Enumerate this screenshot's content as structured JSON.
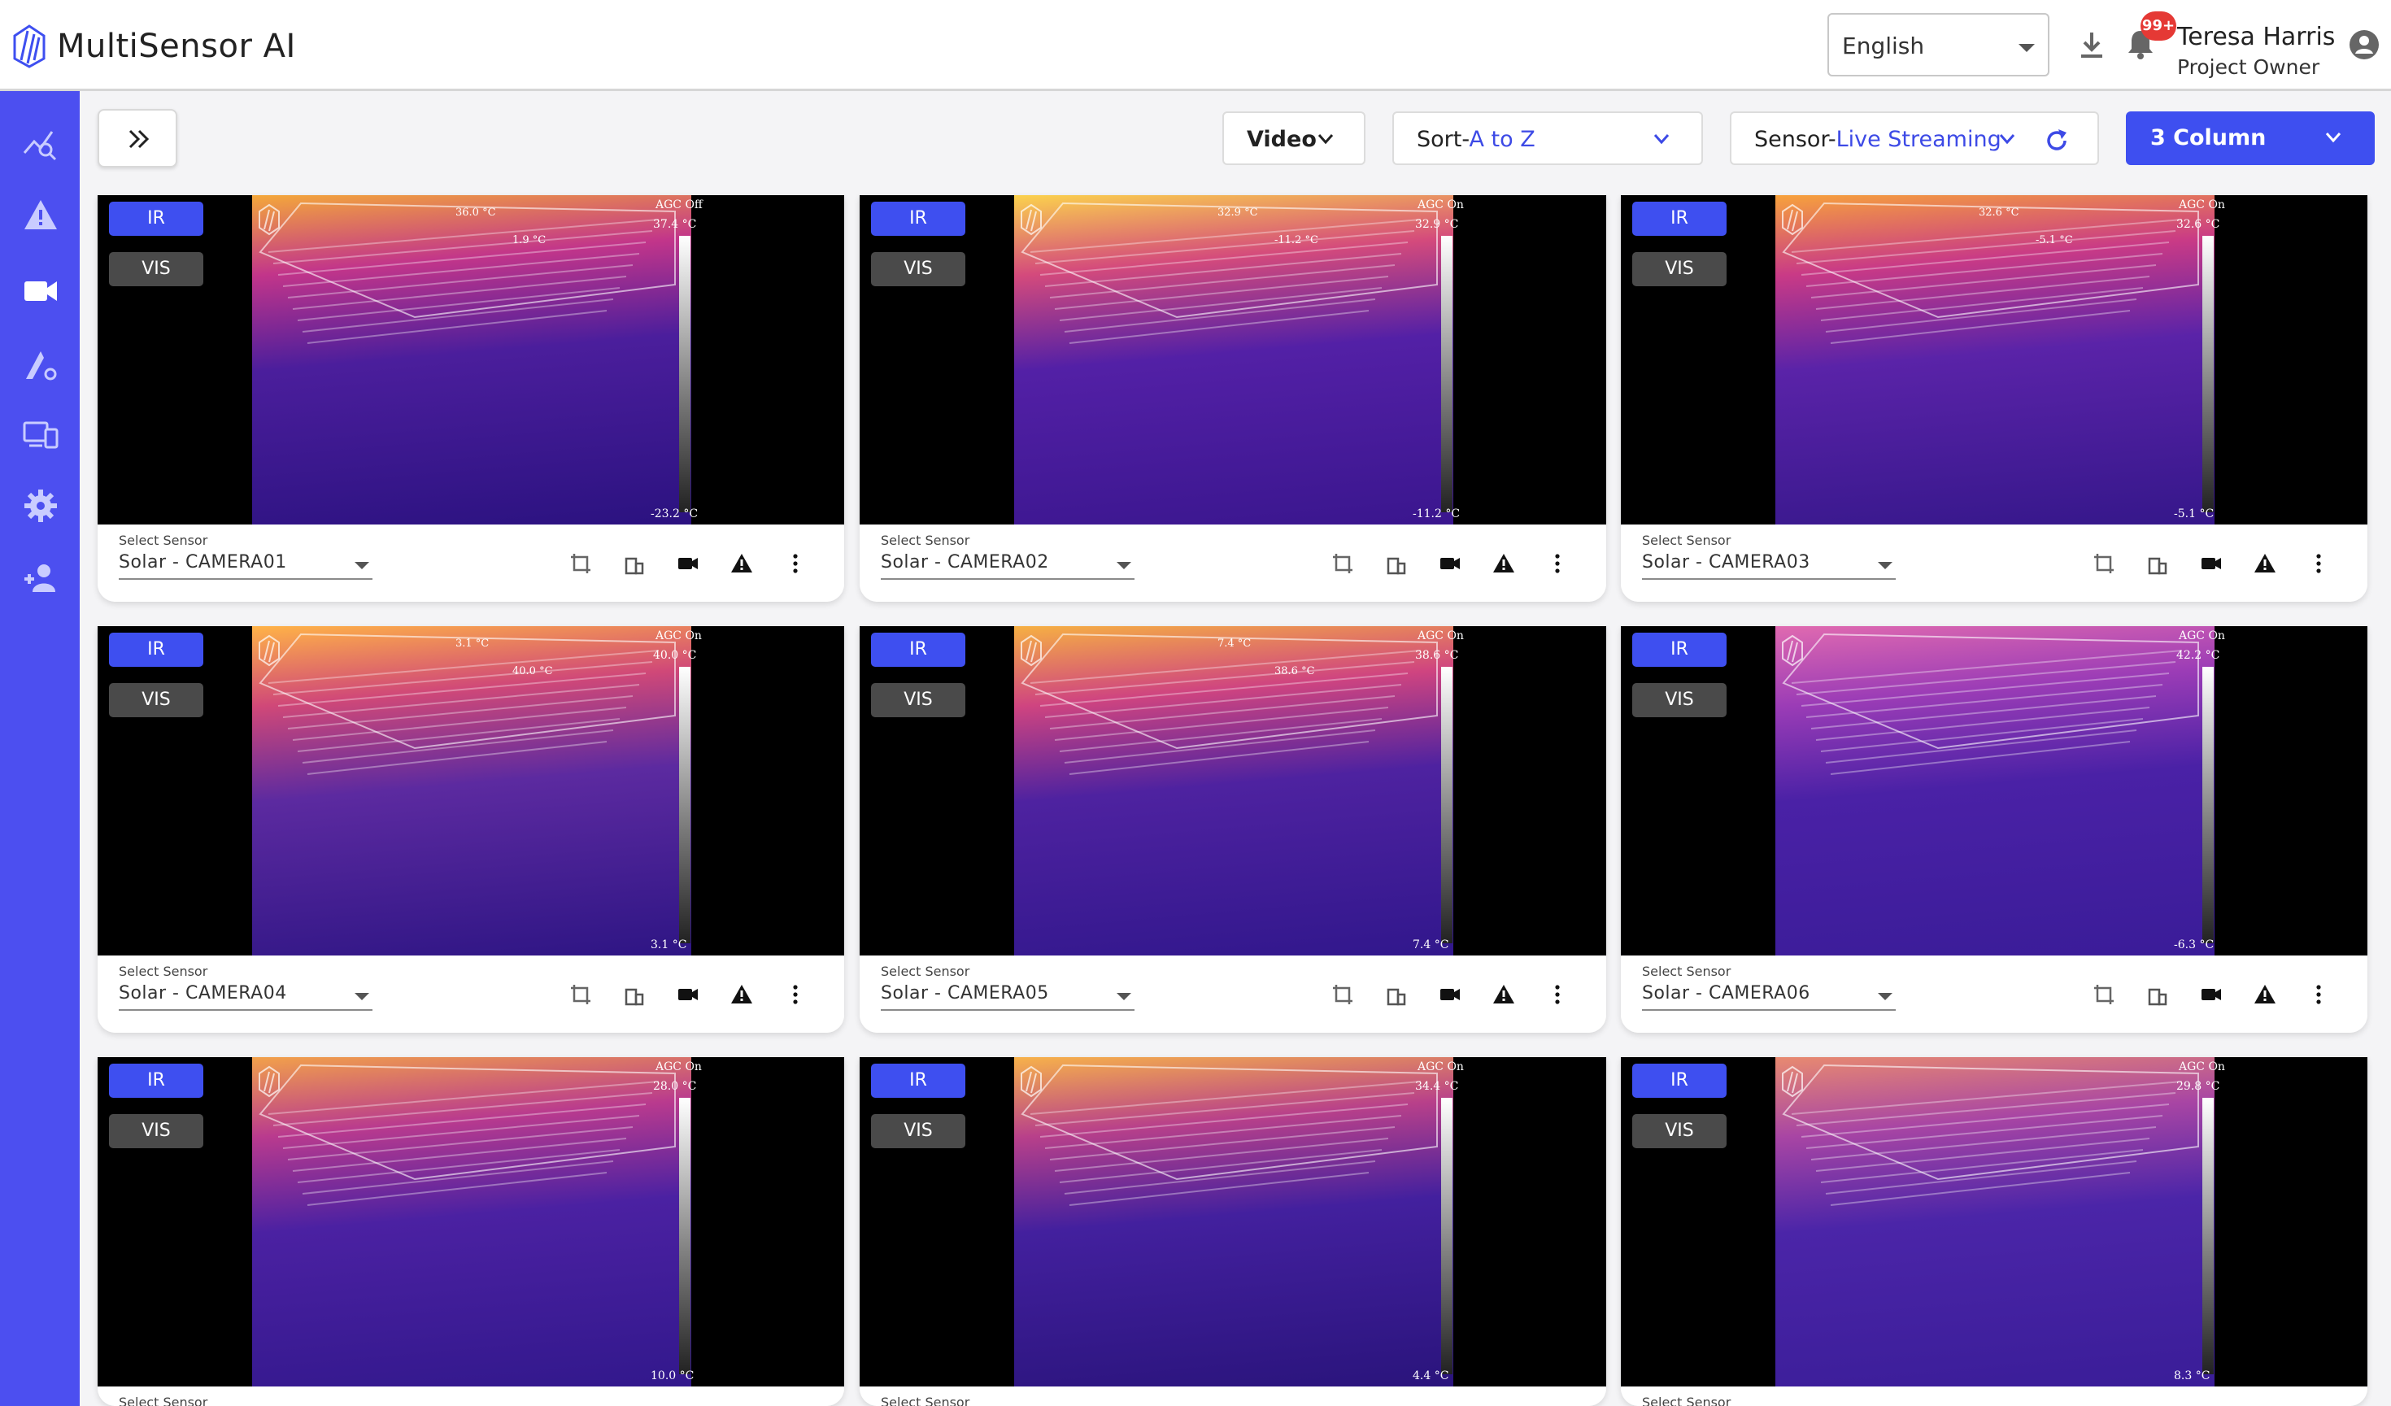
{
  "app": {
    "name": "MultiSensor AI"
  },
  "header": {
    "language": "English",
    "notification_badge": "99+",
    "user_name": "Teresa Harris",
    "user_role": "Project Owner"
  },
  "toolbar": {
    "media_type": "Video",
    "sort_prefix": "Sort-",
    "sort_value": "A to Z",
    "sensor_prefix": "Sensor-",
    "sensor_value": "Live Streaming",
    "columns": "3 Column"
  },
  "colors": {
    "accent": "#3e4ff0",
    "sidebar": "#4c4ff0",
    "vis_button": "#4a4a4a",
    "badge": "#e53935"
  },
  "sidebar_icons": [
    "analytics-icon",
    "alert-triangle-icon",
    "video-camera-icon",
    "site-settings-icon",
    "devices-icon",
    "gear-icon",
    "add-user-icon"
  ],
  "cameras": [
    {
      "ir_label": "IR",
      "vis_label": "VIS",
      "agc": "AGC Off",
      "temp_max": "37.4 °C",
      "temp_min": "-23.2 °C",
      "select_label": "Select Sensor",
      "sensor": "Solar - CAMERA01",
      "spots": [
        "36.0 °C",
        "1.9 °C"
      ]
    },
    {
      "ir_label": "IR",
      "vis_label": "VIS",
      "agc": "AGC On",
      "temp_max": "32.9 °C",
      "temp_min": "-11.2 °C",
      "select_label": "Select Sensor",
      "sensor": "Solar - CAMERA02",
      "spots": [
        "32.9 °C",
        "-11.2 °C"
      ]
    },
    {
      "ir_label": "IR",
      "vis_label": "VIS",
      "agc": "AGC On",
      "temp_max": "32.6 °C",
      "temp_min": "-5.1 °C",
      "select_label": "Select Sensor",
      "sensor": "Solar - CAMERA03",
      "spots": [
        "32.6 °C",
        "-5.1 °C"
      ]
    },
    {
      "ir_label": "IR",
      "vis_label": "VIS",
      "agc": "AGC On",
      "temp_max": "40.0 °C",
      "temp_min": "3.1 °C",
      "select_label": "Select Sensor",
      "sensor": "Solar - CAMERA04",
      "spots": [
        "3.1 °C",
        "40.0 °C"
      ]
    },
    {
      "ir_label": "IR",
      "vis_label": "VIS",
      "agc": "AGC On",
      "temp_max": "38.6 °C",
      "temp_min": "7.4 °C",
      "select_label": "Select Sensor",
      "sensor": "Solar - CAMERA05",
      "spots": [
        "7.4 °C",
        "38.6 °C"
      ]
    },
    {
      "ir_label": "IR",
      "vis_label": "VIS",
      "agc": "AGC On",
      "temp_max": "42.2 °C",
      "temp_min": "-6.3 °C",
      "select_label": "Select Sensor",
      "sensor": "Solar - CAMERA06",
      "spots": []
    },
    {
      "ir_label": "IR",
      "vis_label": "VIS",
      "agc": "AGC On",
      "temp_max": "28.0 °C",
      "temp_min": "10.0 °C",
      "select_label": "Select Sensor",
      "sensor": "",
      "spots": []
    },
    {
      "ir_label": "IR",
      "vis_label": "VIS",
      "agc": "AGC On",
      "temp_max": "34.4 °C",
      "temp_min": "4.4 °C",
      "select_label": "Select Sensor",
      "sensor": "",
      "spots": []
    },
    {
      "ir_label": "IR",
      "vis_label": "VIS",
      "agc": "AGC On",
      "temp_max": "29.8 °C",
      "temp_min": "8.3 °C",
      "select_label": "Select Sensor",
      "sensor": "",
      "spots": []
    }
  ]
}
